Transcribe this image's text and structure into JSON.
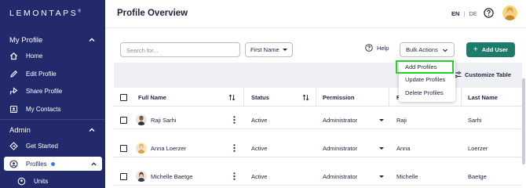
{
  "sidebar": {
    "logo": "LEMONTAPS",
    "logo_mark": "®",
    "sections": [
      {
        "title": "My Profile"
      },
      {
        "title": "Admin"
      }
    ],
    "my_profile_items": [
      {
        "label": "Home",
        "icon": "home-icon"
      },
      {
        "label": "Edit Profile",
        "icon": "pencil-icon"
      },
      {
        "label": "Share Profile",
        "icon": "share-icon"
      },
      {
        "label": "My Contacts",
        "icon": "contacts-icon"
      }
    ],
    "admin_items": [
      {
        "label": "Get Started",
        "icon": "diamond-icon"
      },
      {
        "label": "Profiles",
        "icon": "profiles-icon",
        "active": true
      },
      {
        "label": "Units",
        "icon": "units-icon"
      }
    ]
  },
  "header": {
    "title": "Profile Overview",
    "lang_active": "EN",
    "lang_sep": "|",
    "lang_other": "DE"
  },
  "toolbar": {
    "search_placeholder": "Search for...",
    "filter_value": "First Name",
    "help_label": "Help",
    "bulk_label": "Bulk Actions",
    "add_user_label": "Add User"
  },
  "customize_label": "Customize Table",
  "bulk_menu": [
    "Add Profiles",
    "Update Profiles",
    "Delete Profiles"
  ],
  "table": {
    "columns": [
      "Full Name",
      "Status",
      "Permission",
      "F",
      "Last Name"
    ],
    "rows": [
      {
        "full_name": "Raji Sarhi",
        "status": "Active",
        "permission": "Administrator",
        "first_name": "Raji",
        "last_name": "Sarhi"
      },
      {
        "full_name": "Anna Loerzer",
        "status": "Active",
        "permission": "Administrator",
        "first_name": "Anna",
        "last_name": "Loerzer"
      },
      {
        "full_name": "Michelle Baetge",
        "status": "Active",
        "permission": "Administrator",
        "first_name": "Michelle",
        "last_name": "Baetge"
      }
    ]
  },
  "colors": {
    "sidebar_bg": "#232a6c",
    "primary_button": "#1e7a6a",
    "highlight_outline": "#22d12a",
    "status_dot": "#2e7cf6"
  }
}
